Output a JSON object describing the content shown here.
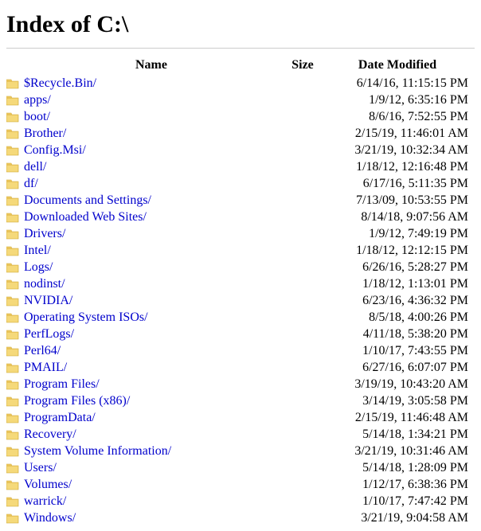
{
  "title": "Index of C:\\",
  "columns": {
    "name": "Name",
    "size": "Size",
    "date": "Date Modified"
  },
  "entries": [
    {
      "name": "$Recycle.Bin/",
      "size": "",
      "date": "6/14/16, 11:15:15 PM"
    },
    {
      "name": "apps/",
      "size": "",
      "date": "1/9/12, 6:35:16 PM"
    },
    {
      "name": "boot/",
      "size": "",
      "date": "8/6/16, 7:52:55 PM"
    },
    {
      "name": "Brother/",
      "size": "",
      "date": "2/15/19, 11:46:01 AM"
    },
    {
      "name": "Config.Msi/",
      "size": "",
      "date": "3/21/19, 10:32:34 AM"
    },
    {
      "name": "dell/",
      "size": "",
      "date": "1/18/12, 12:16:48 PM"
    },
    {
      "name": "df/",
      "size": "",
      "date": "6/17/16, 5:11:35 PM"
    },
    {
      "name": "Documents and Settings/",
      "size": "",
      "date": "7/13/09, 10:53:55 PM"
    },
    {
      "name": "Downloaded Web Sites/",
      "size": "",
      "date": "8/14/18, 9:07:56 AM"
    },
    {
      "name": "Drivers/",
      "size": "",
      "date": "1/9/12, 7:49:19 PM"
    },
    {
      "name": "Intel/",
      "size": "",
      "date": "1/18/12, 12:12:15 PM"
    },
    {
      "name": "Logs/",
      "size": "",
      "date": "6/26/16, 5:28:27 PM"
    },
    {
      "name": "nodinst/",
      "size": "",
      "date": "1/18/12, 1:13:01 PM"
    },
    {
      "name": "NVIDIA/",
      "size": "",
      "date": "6/23/16, 4:36:32 PM"
    },
    {
      "name": "Operating System ISOs/",
      "size": "",
      "date": "8/5/18, 4:00:26 PM"
    },
    {
      "name": "PerfLogs/",
      "size": "",
      "date": "4/11/18, 5:38:20 PM"
    },
    {
      "name": "Perl64/",
      "size": "",
      "date": "1/10/17, 7:43:55 PM"
    },
    {
      "name": "PMAIL/",
      "size": "",
      "date": "6/27/16, 6:07:07 PM"
    },
    {
      "name": "Program Files/",
      "size": "",
      "date": "3/19/19, 10:43:20 AM"
    },
    {
      "name": "Program Files (x86)/",
      "size": "",
      "date": "3/14/19, 3:05:58 PM"
    },
    {
      "name": "ProgramData/",
      "size": "",
      "date": "2/15/19, 11:46:48 AM"
    },
    {
      "name": "Recovery/",
      "size": "",
      "date": "5/14/18, 1:34:21 PM"
    },
    {
      "name": "System Volume Information/",
      "size": "",
      "date": "3/21/19, 10:31:46 AM"
    },
    {
      "name": "Users/",
      "size": "",
      "date": "5/14/18, 1:28:09 PM"
    },
    {
      "name": "Volumes/",
      "size": "",
      "date": "1/12/17, 6:38:36 PM"
    },
    {
      "name": "warrick/",
      "size": "",
      "date": "1/10/17, 7:47:42 PM"
    },
    {
      "name": "Windows/",
      "size": "",
      "date": "3/21/19, 9:04:58 AM"
    }
  ]
}
